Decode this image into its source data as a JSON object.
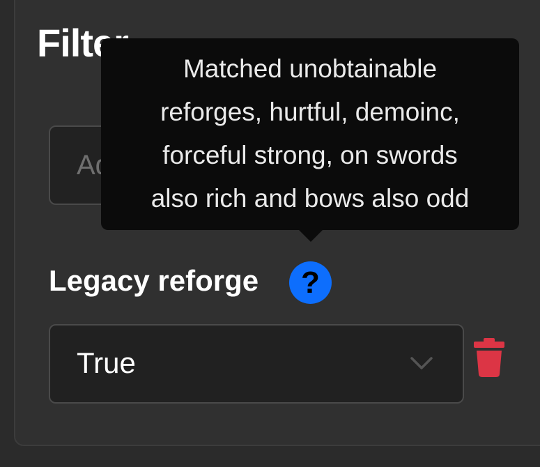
{
  "panel": {
    "title": "Filter"
  },
  "add_filter": {
    "placeholder": "Add filter"
  },
  "filter": {
    "label": "Legacy reforge",
    "help_icon_glyph": "?",
    "select_value": "True",
    "icons": {
      "help": "question-circle-icon",
      "dropdown": "chevron-down-icon",
      "remove": "trash-icon"
    }
  },
  "tooltip": {
    "lines": [
      "Matched unobtainable",
      "reforges, hurtful, demoinc,",
      "forceful strong, on swords",
      "also rich and bows also odd"
    ]
  },
  "colors": {
    "background": "#2b2b2b",
    "panel": "#303030",
    "input_bg": "#212121",
    "accent_blue": "#0d6efd",
    "delete_red": "#dc3545",
    "tooltip_bg": "#0b0b0b"
  }
}
